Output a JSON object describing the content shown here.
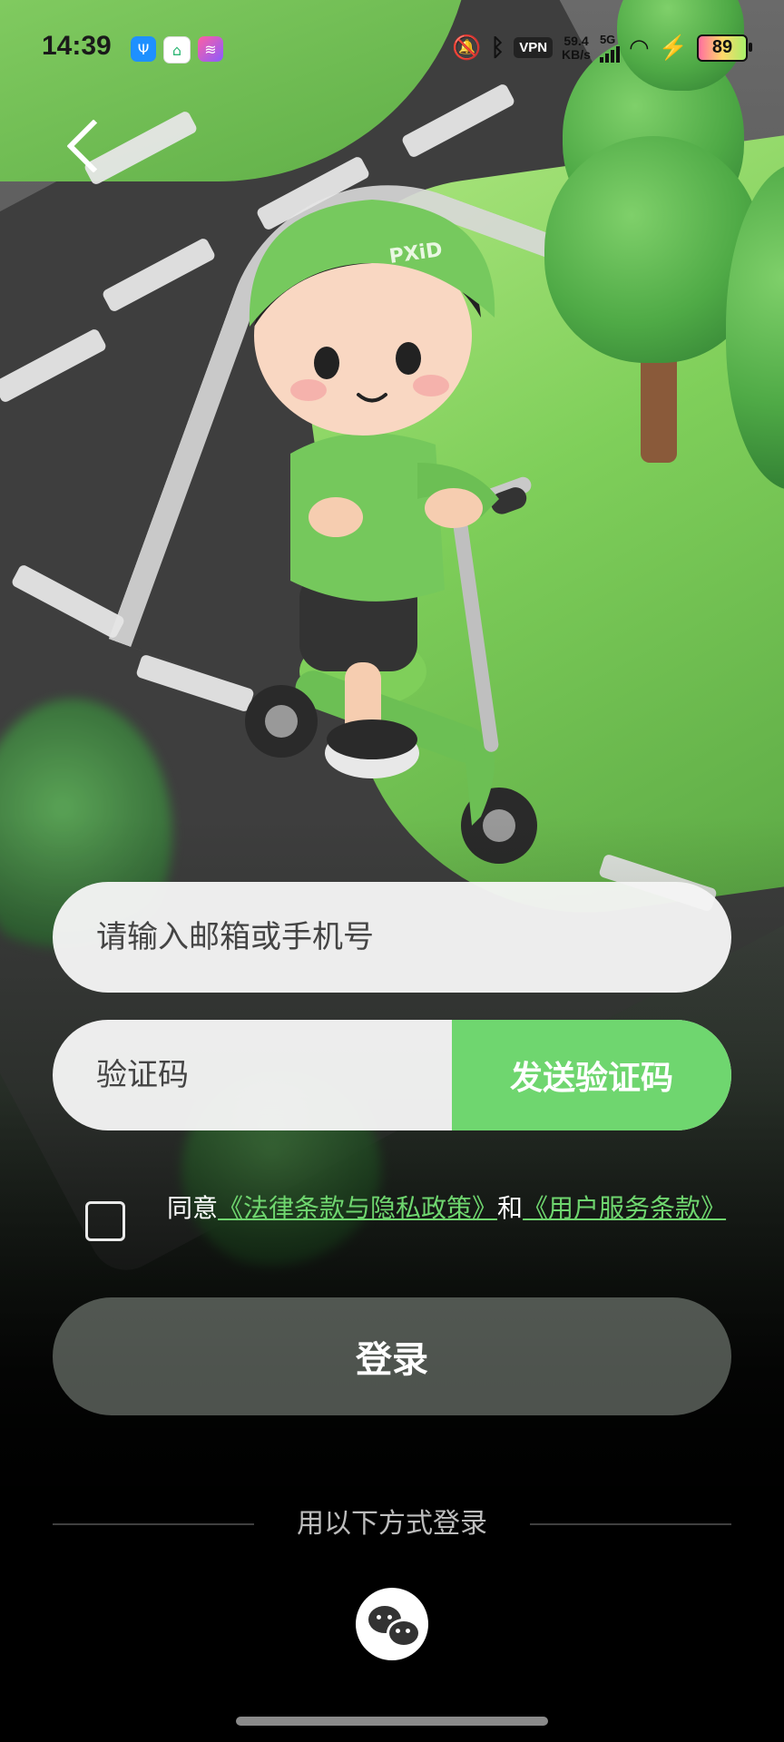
{
  "status_bar": {
    "time": "14:39",
    "app_icons": [
      "usb-icon",
      "home-app-icon",
      "gallery-app-icon"
    ],
    "network_speed_value": "59.4",
    "network_speed_unit": "KB/s",
    "signal_type": "5G",
    "vpn_label": "VPN",
    "battery_level": "89"
  },
  "illustration": {
    "helmet_text": "PXiD"
  },
  "form": {
    "account_placeholder": "请输入邮箱或手机号",
    "code_placeholder": "验证码",
    "send_code_label": "发送验证码",
    "agree_prefix": "同意",
    "legal_link": "《法律条款与隐私政策》",
    "agree_and": "和",
    "service_link": "《用户服务条款》",
    "login_label": "登录"
  },
  "alt_login": {
    "label": "用以下方式登录",
    "providers": [
      "wechat-icon"
    ]
  },
  "colors": {
    "accent_green": "#6fd66f"
  }
}
